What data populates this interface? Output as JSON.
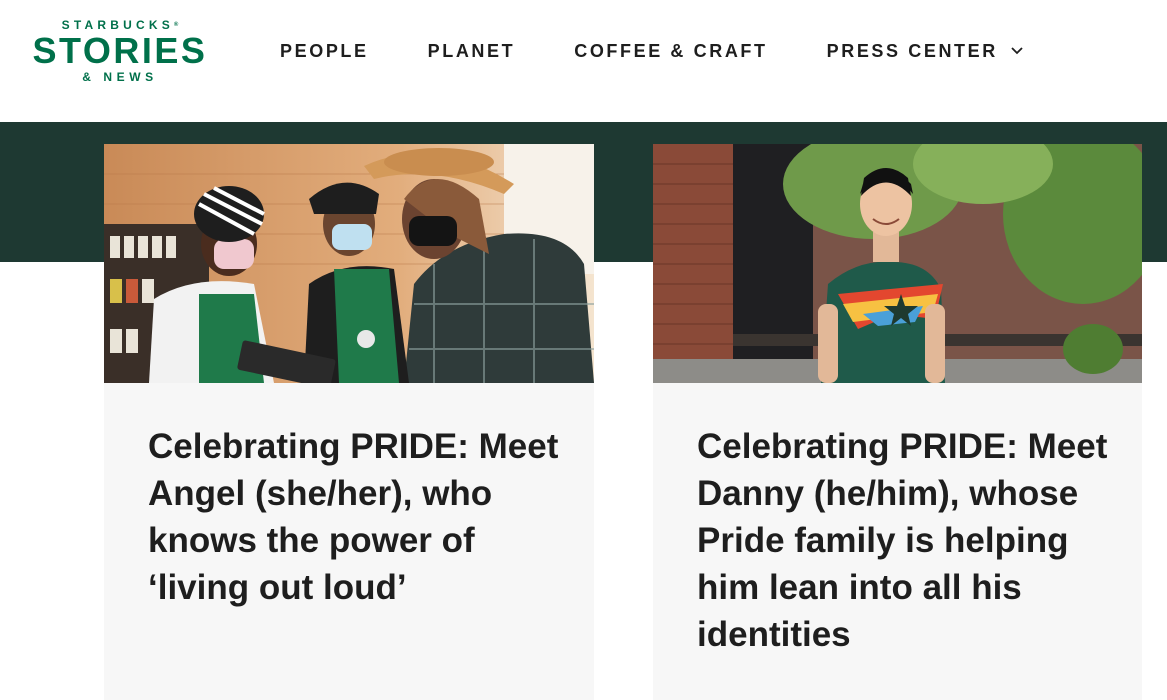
{
  "logo": {
    "line1": "STARBUCKS",
    "reg": "®",
    "line2": "STORIES",
    "line3": "& NEWS",
    "color": "#00704a"
  },
  "nav": {
    "items": [
      {
        "label": "PEOPLE"
      },
      {
        "label": "PLANET"
      },
      {
        "label": "COFFEE & CRAFT"
      },
      {
        "label": "PRESS CENTER",
        "icon": "chevron-down-icon"
      }
    ]
  },
  "colors": {
    "band": "#1e3932",
    "card_bg": "#f7f7f7",
    "brand_green": "#00704a"
  },
  "cards": [
    {
      "title": "Celebrating PRIDE: Meet Angel (she/her), who knows the power of ‘living out loud’"
    },
    {
      "title": "Celebrating PRIDE: Meet Danny (he/him), whose Pride family is helping him lean into all his identities"
    }
  ]
}
